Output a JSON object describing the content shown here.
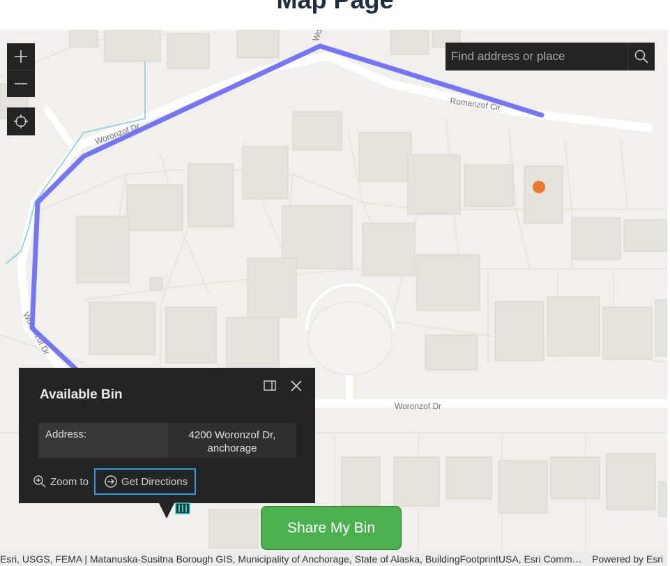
{
  "page": {
    "title": "Map Page"
  },
  "map": {
    "street_labels": {
      "woronzof_top": "Woronzof Dr",
      "woronzof_cut": "Woronzof",
      "romanzof": "Romanzof Cir",
      "woronzof_left": "Woronzof Dr",
      "woronzof_bottom": "Woronzof Dr"
    },
    "route_color": "#6f6ff5",
    "marker_color": "#e8792a"
  },
  "controls": {
    "zoom_in_icon": "plus-icon",
    "zoom_out_icon": "minus-icon",
    "locate_icon": "crosshair-icon"
  },
  "search": {
    "placeholder": "Find address or place",
    "icon": "search-icon"
  },
  "popup": {
    "title": "Available Bin",
    "fields": [
      {
        "label": "Address:",
        "value": "4200 Woronzof Dr, anchorage"
      }
    ],
    "actions": {
      "zoom_to": "Zoom to",
      "get_directions": "Get Directions"
    }
  },
  "share_button": {
    "label": "Share My Bin",
    "color": "#4caf50"
  },
  "attribution": {
    "text": "Esri, USGS, FEMA | Matanuska-Susitna Borough GIS, Municipality of Anchorage, State of Alaska, BuildingFootprintUSA, Esri Community Maps contributors",
    "powered_by": "Powered by Esri"
  }
}
